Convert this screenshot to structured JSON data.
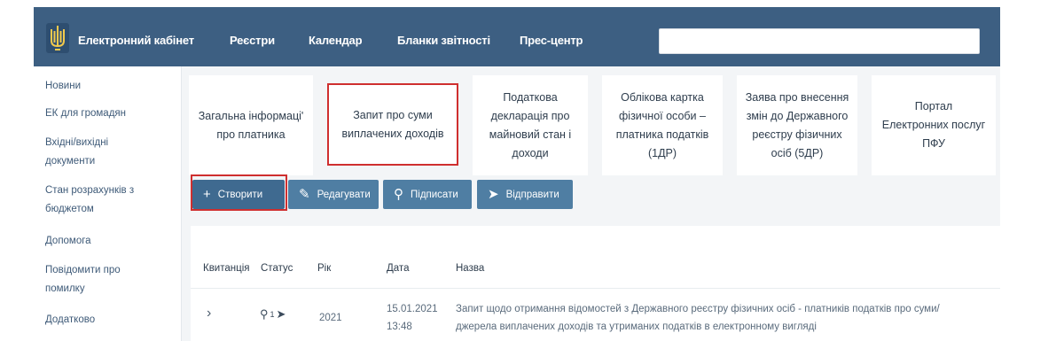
{
  "header": {
    "brand": "Електронний кабінет",
    "nav": [
      "Реєстри",
      "Календар",
      "Бланки звітності",
      "Прес-центр"
    ],
    "search_value": ""
  },
  "sidebar": {
    "items": [
      "Новини",
      "ЕК для громадян",
      "Вхідні/вихідні документи",
      "Стан розрахунків з бюджетом",
      "Допомога",
      "Повідомити про помилку",
      "Додатково"
    ]
  },
  "cards": [
    {
      "lines": [
        "Загальна інформаці'",
        "про платника"
      ]
    },
    {
      "lines": [
        "Запит про суми",
        "виплачених доходів"
      ],
      "selected": true
    },
    {
      "lines": [
        "Податкова",
        "декларація про",
        "майновий стан і",
        "доходи"
      ]
    },
    {
      "lines": [
        "Облікова картка",
        "фізичної особи –",
        "платника податків",
        "(1ДР)"
      ]
    },
    {
      "lines": [
        "Заява про внесення",
        "змін до Державного",
        "реєстру фізичних",
        "осіб (5ДР)"
      ]
    },
    {
      "lines": [
        "Портал",
        "Електронних послуг",
        "ПФУ"
      ]
    }
  ],
  "toolbar": {
    "create": "Створити",
    "edit": "Редагувати",
    "sign": "Підписати",
    "send": "Відправити"
  },
  "table": {
    "headers": [
      "Квитанція",
      "Статус",
      "Рік",
      "Дата",
      "Назва"
    ],
    "rows": [
      {
        "status_count": "1",
        "year": "2021",
        "date": "15.01.2021",
        "time": "13:48",
        "name_line1": "Запит щодо отримання відомостей з Державного реєстру фізичних осіб - платників податків про суми/",
        "name_line2": "джерела виплачених доходів та утриманих податків в електронному вигляді"
      }
    ]
  },
  "colors": {
    "header_bg": "#3d5f82",
    "button_bg": "#4f7ea3",
    "highlight": "#cf2f2f"
  }
}
